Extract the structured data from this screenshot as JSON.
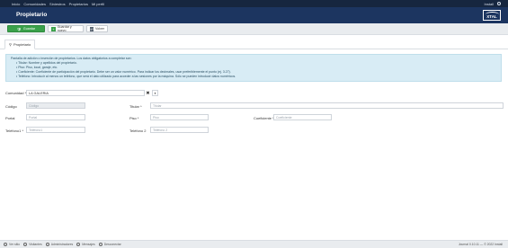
{
  "topnav": {
    "items": [
      "Inicio",
      "Comunidades",
      "Siniestros",
      "Propietarios",
      "Mi perfil"
    ],
    "user": "Install"
  },
  "header": {
    "title": "Propietario",
    "logo_text": "XTAL"
  },
  "toolbar": {
    "save_label": "Guardar",
    "save_new_label": "Guardar y nuevo",
    "back_label": "Volver"
  },
  "tabs": [
    {
      "label": "Propietario"
    }
  ],
  "help": {
    "intro": "Pantalla de adición o inserción de propietarios. Los datos obligatorios a completar son:",
    "items": [
      "Titular: Nombre y apellidos del propietario.",
      "Piso: Piso, local, garaje, etc.",
      "Coeficiente: Coeficiente de participación del propietario. Debe ser un valor numérico. Para indicar los decimales, usar preferiblemente el punto (ej. 3.27).",
      "Teléfono: Introducir al menos un teléfono, que será el dato utilizado para acceder a las sesiones por la máquina. Sólo se pueden introducir datos numéricos."
    ]
  },
  "form": {
    "comunidad_label": "Comunidad *",
    "comunidad_value": "LA GALERIA",
    "codigo_label": "Código",
    "codigo_placeholder": "Código",
    "titular_label": "Titular *",
    "titular_placeholder": "Titular",
    "portal_label": "Portal",
    "portal_placeholder": "Portal",
    "piso_label": "Piso *",
    "piso_placeholder": "Piso",
    "coeficiente_label": "Coeficiente *",
    "coeficiente_placeholder": "Coeficiente",
    "telefono1_label": "Teléfono1 *",
    "telefono1_placeholder": "Teléfono1",
    "telefono2_label": "Teléfono 2",
    "telefono2_placeholder": "Teléfono 2"
  },
  "footer": {
    "items": [
      "Ver sitio",
      "Visitantes",
      "Administradores",
      "Mensajes",
      "Desconectar"
    ],
    "copyright": "Journal 0.10.11 — © 2022 Install"
  }
}
